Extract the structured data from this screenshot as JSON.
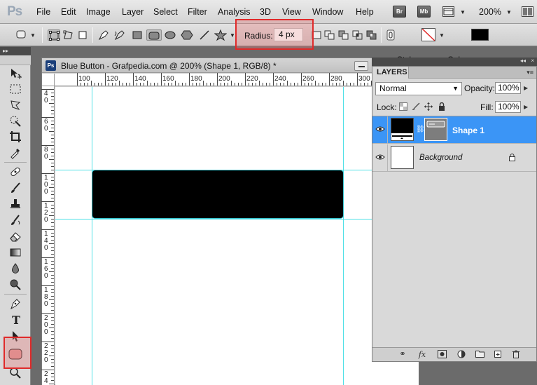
{
  "app": {
    "logo": "Ps"
  },
  "menu": {
    "items": [
      "File",
      "Edit",
      "Image",
      "Layer",
      "Select",
      "Filter",
      "Analysis",
      "3D",
      "View",
      "Window",
      "Help"
    ],
    "bridge": "Br",
    "minibridge": "Mb",
    "zoom": "200%"
  },
  "options_bar": {
    "radius_label": "Radius:",
    "radius_value": "4 px",
    "style_label": "Style:",
    "color_label": "Color:",
    "color_value": "#000000"
  },
  "document": {
    "badge": "Ps",
    "title": "Blue Button - Grafpedia.com @ 200% (Shape 1, RGB/8) *",
    "ruler_h_labels": [
      "100",
      "120",
      "140",
      "160",
      "180",
      "200",
      "220",
      "240",
      "260",
      "280",
      "300"
    ],
    "ruler_v_labels": [
      "4 0",
      "6 0",
      "8 0",
      "1 0 0",
      "1 2 0",
      "1 4 0",
      "1 6 0",
      "1 8 0",
      "2 0 0",
      "2 2 0",
      "2 4 0"
    ]
  },
  "layers_panel": {
    "tab": "LAYERS",
    "blend_mode": "Normal",
    "opacity_label": "Opacity:",
    "opacity_value": "100%",
    "lock_label": "Lock:",
    "fill_label": "Fill:",
    "fill_value": "100%",
    "layers": [
      {
        "name": "Shape 1",
        "selected": true
      },
      {
        "name": "Background",
        "selected": false,
        "locked": true
      }
    ]
  },
  "colors": {
    "accent_highlight": "#e02a2a",
    "layer_selected": "#3b95f6",
    "guide": "#4fe0e6"
  }
}
